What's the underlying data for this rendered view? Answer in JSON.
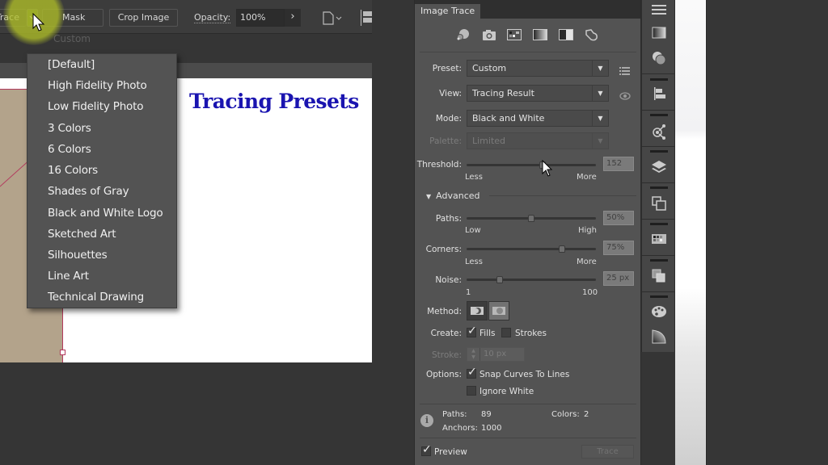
{
  "control_bar": {
    "image_trace_label": "Image Trace",
    "mask_label": "Mask",
    "crop_image_label": "Crop Image",
    "opacity_label": "Opacity:",
    "opacity_value": "100%"
  },
  "preset_menu": {
    "current_hint": "Custom",
    "items": [
      "[Default]",
      "High Fidelity Photo",
      "Low Fidelity Photo",
      "3 Colors",
      "6 Colors",
      "16 Colors",
      "Shades of Gray",
      "Black and White Logo",
      "Sketched Art",
      "Silhouettes",
      "Line Art",
      "Technical Drawing"
    ]
  },
  "canvas": {
    "title": "Tracing Presets",
    "title_color": "#1a14b0"
  },
  "panel": {
    "tab_title": "Image Trace",
    "preset_icons": [
      "auto-color",
      "high-color",
      "low-color",
      "grayscale",
      "black-and-white",
      "outline"
    ],
    "preset": {
      "label": "Preset:",
      "value": "Custom"
    },
    "view": {
      "label": "View:",
      "value": "Tracing Result"
    },
    "mode": {
      "label": "Mode:",
      "value": "Black and White"
    },
    "palette": {
      "label": "Palette:",
      "value": "Limited",
      "disabled": true
    },
    "threshold": {
      "label": "Threshold:",
      "value": "152",
      "min_label": "Less",
      "max_label": "More",
      "min": 1,
      "max": 255,
      "current": 152
    },
    "advanced_label": "Advanced",
    "paths": {
      "label": "Paths:",
      "value": "50%",
      "min_label": "Low",
      "max_label": "High",
      "fraction": 0.5
    },
    "corners": {
      "label": "Corners:",
      "value": "75%",
      "min_label": "Less",
      "max_label": "More",
      "fraction": 0.75
    },
    "noise": {
      "label": "Noise:",
      "value": "25 px",
      "min_label": "1",
      "max_label": "100",
      "min": 1,
      "max": 100,
      "current": 25
    },
    "method": {
      "label": "Method:",
      "options": [
        "Abutting",
        "Overlapping"
      ],
      "selected": "Overlapping"
    },
    "create": {
      "label": "Create:",
      "fills_label": "Fills",
      "fills_checked": true,
      "strokes_label": "Strokes",
      "strokes_checked": false
    },
    "stroke": {
      "label": "Stroke:",
      "value": "10 px",
      "disabled": true
    },
    "options": {
      "label": "Options:",
      "snap_label": "Snap Curves To Lines",
      "snap_checked": true,
      "ignore_white_label": "Ignore White",
      "ignore_white_checked": false
    },
    "stats": {
      "paths_label": "Paths:",
      "paths_value": "89",
      "anchors_label": "Anchors:",
      "anchors_value": "1000",
      "colors_label": "Colors:",
      "colors_value": "2"
    },
    "preview_label": "Preview",
    "preview_checked": true,
    "trace_label": "Trace"
  },
  "dock": {
    "icons": [
      "panel-menu",
      "gradient",
      "transparency",
      "align",
      "links",
      "layers",
      "artboards",
      "swatches",
      "pathfinder",
      "color-guide",
      "color"
    ]
  }
}
